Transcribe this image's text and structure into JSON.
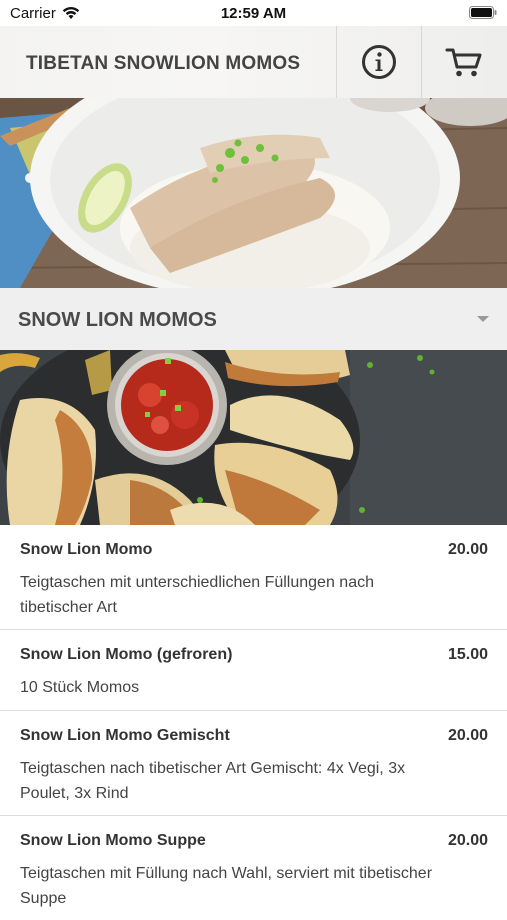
{
  "status_bar": {
    "carrier": "Carrier",
    "time": "12:59 AM"
  },
  "header": {
    "title": "TIBETAN SNOWLION MOMOS",
    "info_icon": "info-icon",
    "cart_icon": "cart-icon"
  },
  "category": {
    "label": "SNOW LION MOMOS",
    "expand_icon": "chevron-down-icon"
  },
  "menu_items": [
    {
      "name": "Snow Lion Momo",
      "price": "20.00",
      "description": "Teigtaschen mit unterschiedlichen Füllungen nach tibetischer Art"
    },
    {
      "name": "Snow Lion Momo (gefroren)",
      "price": "15.00",
      "description": "10 Stück Momos"
    },
    {
      "name": "Snow Lion Momo Gemischt",
      "price": "20.00",
      "description": "Teigtaschen nach tibetischer Art Gemischt: 4x Vegi, 3x Poulet, 3x Rind"
    },
    {
      "name": "Snow Lion Momo Suppe",
      "price": "20.00",
      "description": "Teigtaschen mit Füllung nach Wahl, serviert mit tibetischer Suppe"
    }
  ]
}
